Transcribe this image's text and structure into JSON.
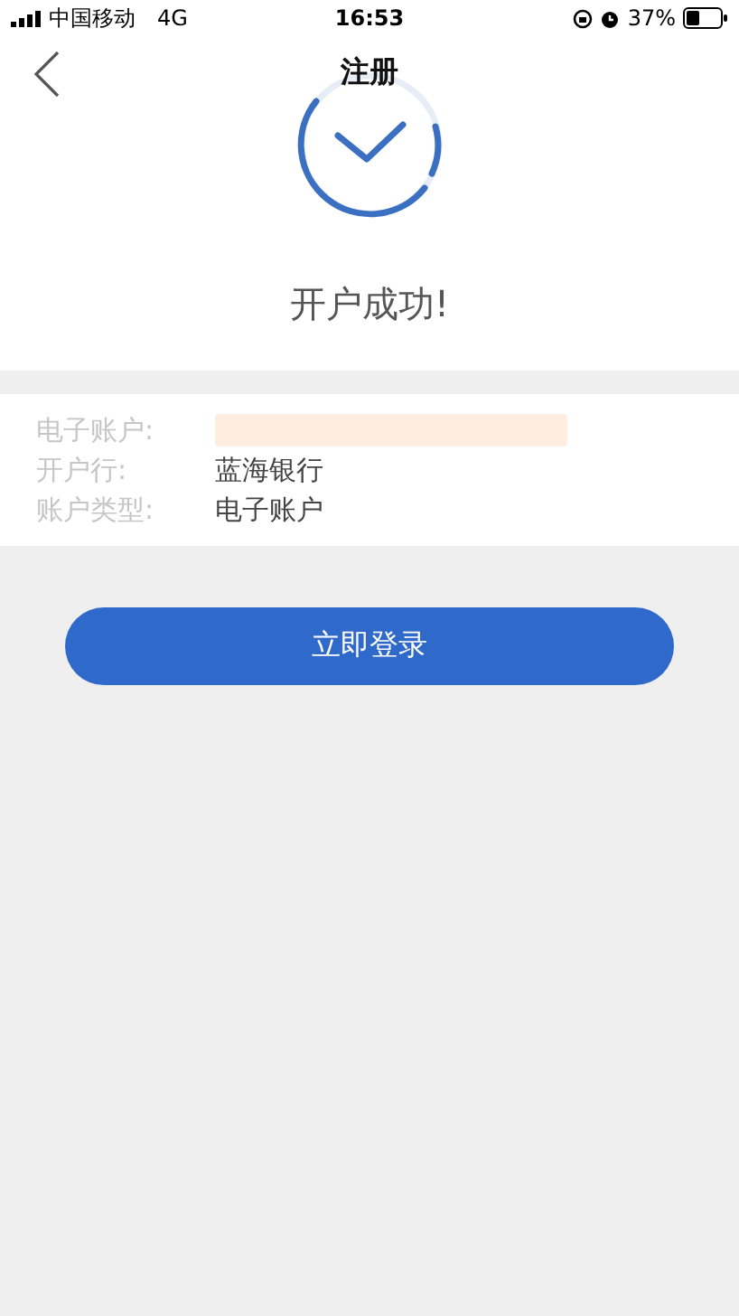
{
  "status_bar": {
    "carrier": "中国移动",
    "network": "4G",
    "time": "16:53",
    "battery_percent": "37%"
  },
  "nav": {
    "title": "注册"
  },
  "result": {
    "message": "开户成功!"
  },
  "info_rows": [
    {
      "label": "电子账户:",
      "kind": "redacted"
    },
    {
      "label": "开户行:",
      "kind": "text",
      "value": "蓝海银行"
    },
    {
      "label": "账户类型:",
      "kind": "text",
      "value": "电子账户"
    }
  ],
  "login_button": {
    "label": "立即登录"
  }
}
